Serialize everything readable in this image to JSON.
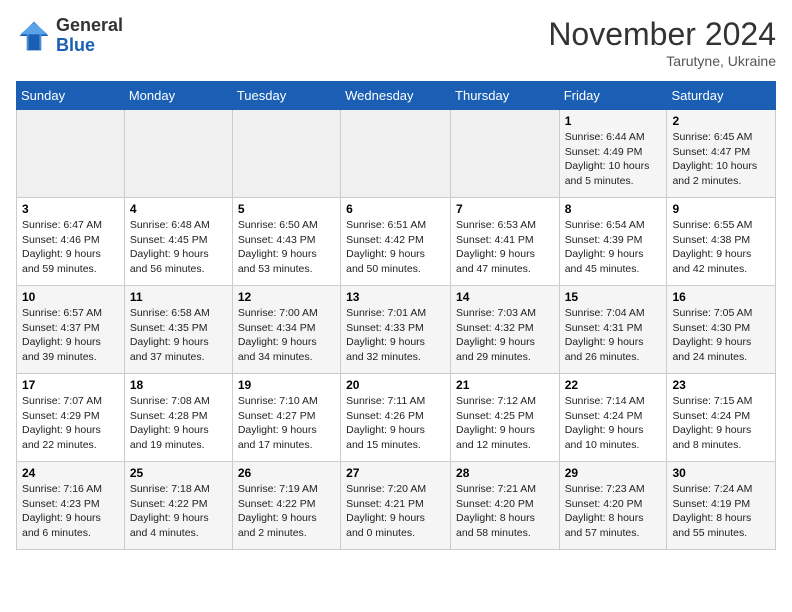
{
  "logo": {
    "general": "General",
    "blue": "Blue"
  },
  "header": {
    "month": "November 2024",
    "location": "Tarutyne, Ukraine"
  },
  "days_of_week": [
    "Sunday",
    "Monday",
    "Tuesday",
    "Wednesday",
    "Thursday",
    "Friday",
    "Saturday"
  ],
  "weeks": [
    [
      {
        "day": "",
        "info": ""
      },
      {
        "day": "",
        "info": ""
      },
      {
        "day": "",
        "info": ""
      },
      {
        "day": "",
        "info": ""
      },
      {
        "day": "",
        "info": ""
      },
      {
        "day": "1",
        "info": "Sunrise: 6:44 AM\nSunset: 4:49 PM\nDaylight: 10 hours\nand 5 minutes."
      },
      {
        "day": "2",
        "info": "Sunrise: 6:45 AM\nSunset: 4:47 PM\nDaylight: 10 hours\nand 2 minutes."
      }
    ],
    [
      {
        "day": "3",
        "info": "Sunrise: 6:47 AM\nSunset: 4:46 PM\nDaylight: 9 hours\nand 59 minutes."
      },
      {
        "day": "4",
        "info": "Sunrise: 6:48 AM\nSunset: 4:45 PM\nDaylight: 9 hours\nand 56 minutes."
      },
      {
        "day": "5",
        "info": "Sunrise: 6:50 AM\nSunset: 4:43 PM\nDaylight: 9 hours\nand 53 minutes."
      },
      {
        "day": "6",
        "info": "Sunrise: 6:51 AM\nSunset: 4:42 PM\nDaylight: 9 hours\nand 50 minutes."
      },
      {
        "day": "7",
        "info": "Sunrise: 6:53 AM\nSunset: 4:41 PM\nDaylight: 9 hours\nand 47 minutes."
      },
      {
        "day": "8",
        "info": "Sunrise: 6:54 AM\nSunset: 4:39 PM\nDaylight: 9 hours\nand 45 minutes."
      },
      {
        "day": "9",
        "info": "Sunrise: 6:55 AM\nSunset: 4:38 PM\nDaylight: 9 hours\nand 42 minutes."
      }
    ],
    [
      {
        "day": "10",
        "info": "Sunrise: 6:57 AM\nSunset: 4:37 PM\nDaylight: 9 hours\nand 39 minutes."
      },
      {
        "day": "11",
        "info": "Sunrise: 6:58 AM\nSunset: 4:35 PM\nDaylight: 9 hours\nand 37 minutes."
      },
      {
        "day": "12",
        "info": "Sunrise: 7:00 AM\nSunset: 4:34 PM\nDaylight: 9 hours\nand 34 minutes."
      },
      {
        "day": "13",
        "info": "Sunrise: 7:01 AM\nSunset: 4:33 PM\nDaylight: 9 hours\nand 32 minutes."
      },
      {
        "day": "14",
        "info": "Sunrise: 7:03 AM\nSunset: 4:32 PM\nDaylight: 9 hours\nand 29 minutes."
      },
      {
        "day": "15",
        "info": "Sunrise: 7:04 AM\nSunset: 4:31 PM\nDaylight: 9 hours\nand 26 minutes."
      },
      {
        "day": "16",
        "info": "Sunrise: 7:05 AM\nSunset: 4:30 PM\nDaylight: 9 hours\nand 24 minutes."
      }
    ],
    [
      {
        "day": "17",
        "info": "Sunrise: 7:07 AM\nSunset: 4:29 PM\nDaylight: 9 hours\nand 22 minutes."
      },
      {
        "day": "18",
        "info": "Sunrise: 7:08 AM\nSunset: 4:28 PM\nDaylight: 9 hours\nand 19 minutes."
      },
      {
        "day": "19",
        "info": "Sunrise: 7:10 AM\nSunset: 4:27 PM\nDaylight: 9 hours\nand 17 minutes."
      },
      {
        "day": "20",
        "info": "Sunrise: 7:11 AM\nSunset: 4:26 PM\nDaylight: 9 hours\nand 15 minutes."
      },
      {
        "day": "21",
        "info": "Sunrise: 7:12 AM\nSunset: 4:25 PM\nDaylight: 9 hours\nand 12 minutes."
      },
      {
        "day": "22",
        "info": "Sunrise: 7:14 AM\nSunset: 4:24 PM\nDaylight: 9 hours\nand 10 minutes."
      },
      {
        "day": "23",
        "info": "Sunrise: 7:15 AM\nSunset: 4:24 PM\nDaylight: 9 hours\nand 8 minutes."
      }
    ],
    [
      {
        "day": "24",
        "info": "Sunrise: 7:16 AM\nSunset: 4:23 PM\nDaylight: 9 hours\nand 6 minutes."
      },
      {
        "day": "25",
        "info": "Sunrise: 7:18 AM\nSunset: 4:22 PM\nDaylight: 9 hours\nand 4 minutes."
      },
      {
        "day": "26",
        "info": "Sunrise: 7:19 AM\nSunset: 4:22 PM\nDaylight: 9 hours\nand 2 minutes."
      },
      {
        "day": "27",
        "info": "Sunrise: 7:20 AM\nSunset: 4:21 PM\nDaylight: 9 hours\nand 0 minutes."
      },
      {
        "day": "28",
        "info": "Sunrise: 7:21 AM\nSunset: 4:20 PM\nDaylight: 8 hours\nand 58 minutes."
      },
      {
        "day": "29",
        "info": "Sunrise: 7:23 AM\nSunset: 4:20 PM\nDaylight: 8 hours\nand 57 minutes."
      },
      {
        "day": "30",
        "info": "Sunrise: 7:24 AM\nSunset: 4:19 PM\nDaylight: 8 hours\nand 55 minutes."
      }
    ]
  ]
}
